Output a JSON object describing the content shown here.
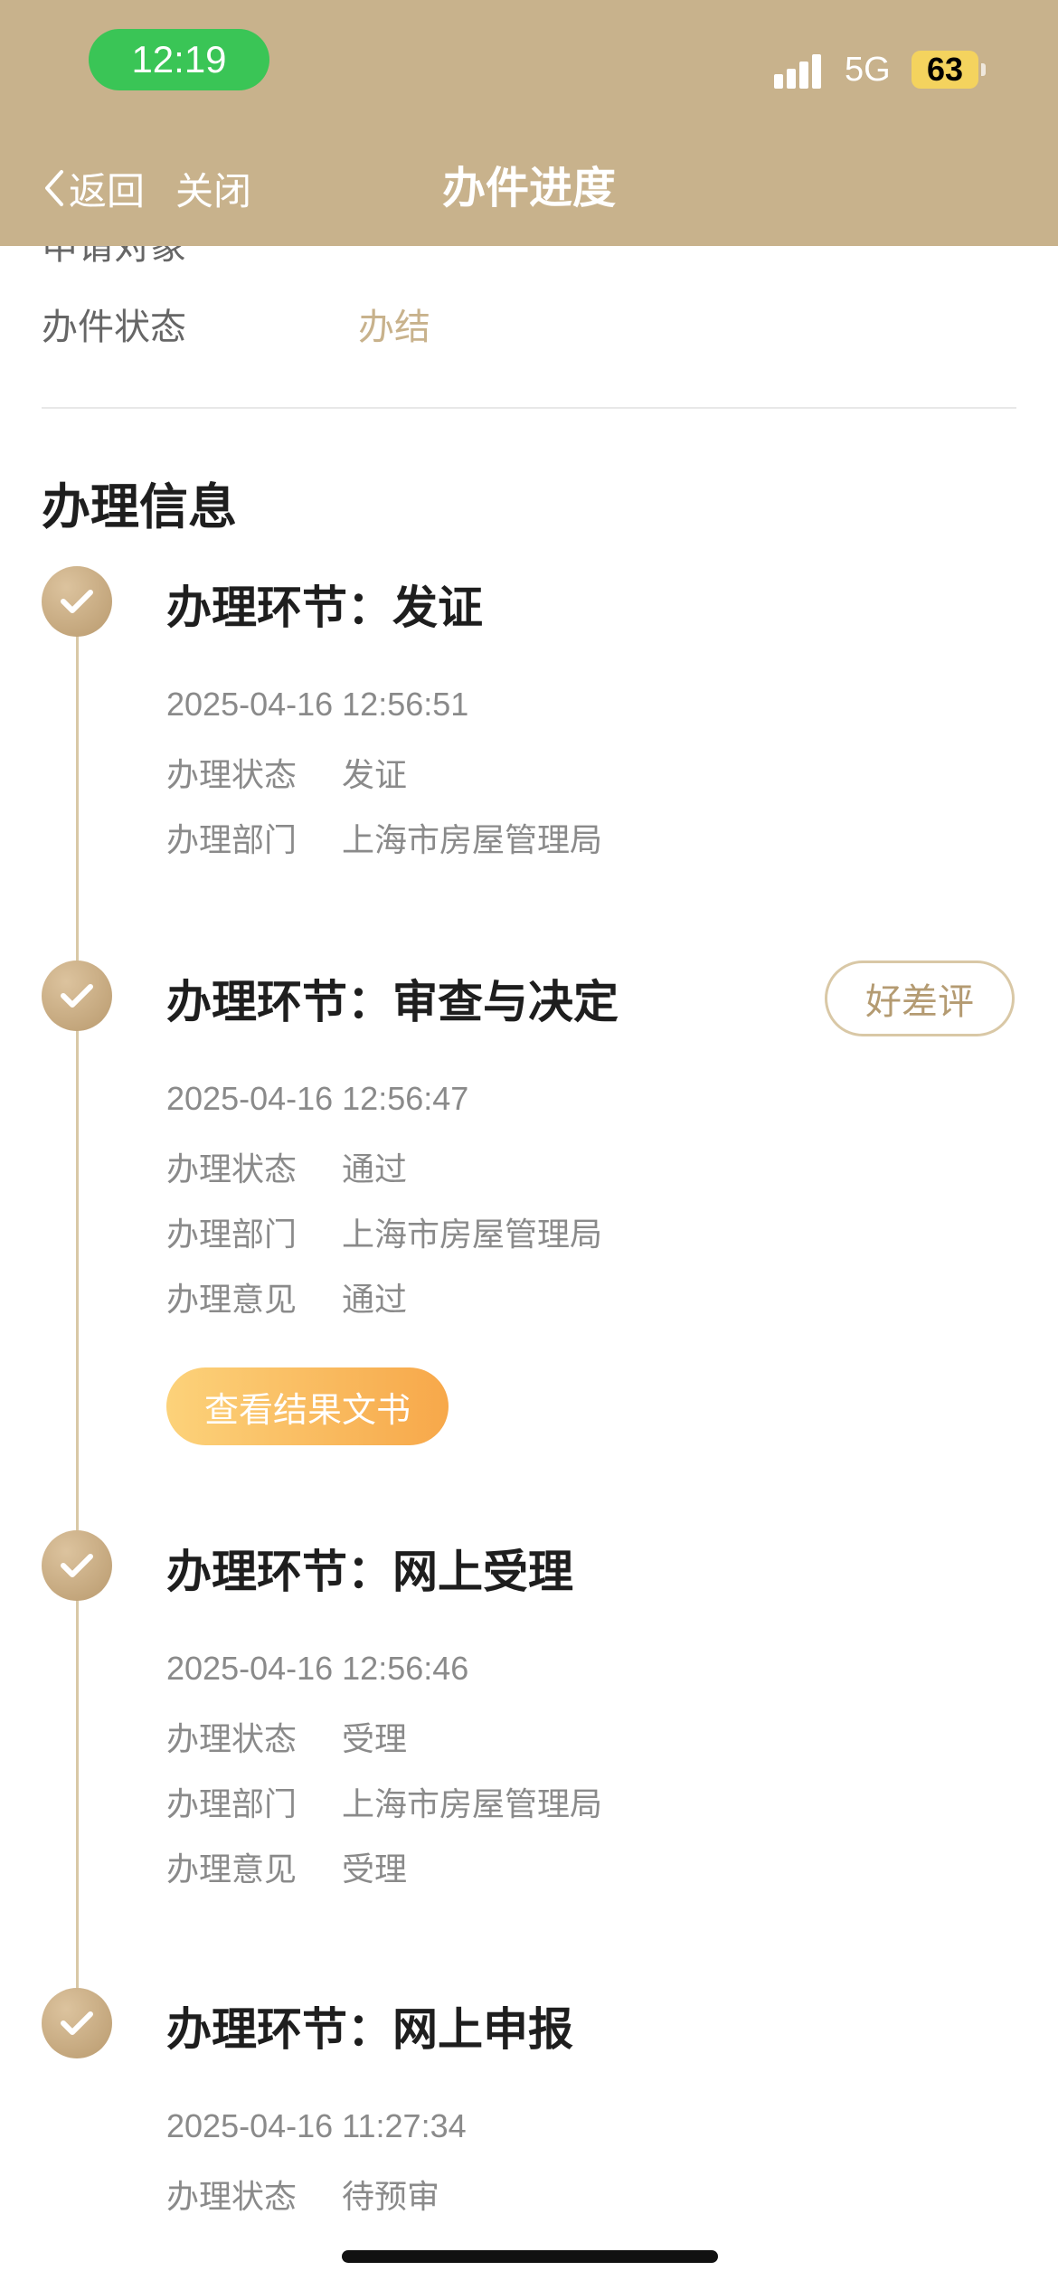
{
  "status_bar": {
    "time": "12:19",
    "network": "5G",
    "battery": "63"
  },
  "nav": {
    "back_label": "返回",
    "close_label": "关闭",
    "title": "办件进度"
  },
  "summary": {
    "partial_label": "申请对象",
    "status_label": "办件状态",
    "status_value": "办结",
    "status_value_color": "#c8b28c"
  },
  "section": {
    "title": "办理信息"
  },
  "steps": [
    {
      "title": "办理环节：发证",
      "time": "2025-04-16 12:56:51",
      "fields": [
        {
          "label": "办理状态",
          "value": "发证"
        },
        {
          "label": "办理部门",
          "value": "上海市房屋管理局"
        }
      ]
    },
    {
      "title": "办理环节：审查与决定",
      "time": "2025-04-16 12:56:47",
      "fields": [
        {
          "label": "办理状态",
          "value": "通过"
        },
        {
          "label": "办理部门",
          "value": "上海市房屋管理局"
        },
        {
          "label": "办理意见",
          "value": "通过"
        }
      ],
      "rate_button": "好差评",
      "result_button": "查看结果文书"
    },
    {
      "title": "办理环节：网上受理",
      "time": "2025-04-16 12:56:46",
      "fields": [
        {
          "label": "办理状态",
          "value": "受理"
        },
        {
          "label": "办理部门",
          "value": "上海市房屋管理局"
        },
        {
          "label": "办理意见",
          "value": "受理"
        }
      ]
    },
    {
      "title": "办理环节：网上申报",
      "time": "2025-04-16 11:27:34",
      "fields": [
        {
          "label": "办理状态",
          "value": "待预审"
        }
      ]
    }
  ],
  "colors": {
    "header_bg": "#c8b28c",
    "accent": "#c8b28c",
    "result_button_gradient": [
      "#fcd27a",
      "#f7a84a"
    ]
  }
}
